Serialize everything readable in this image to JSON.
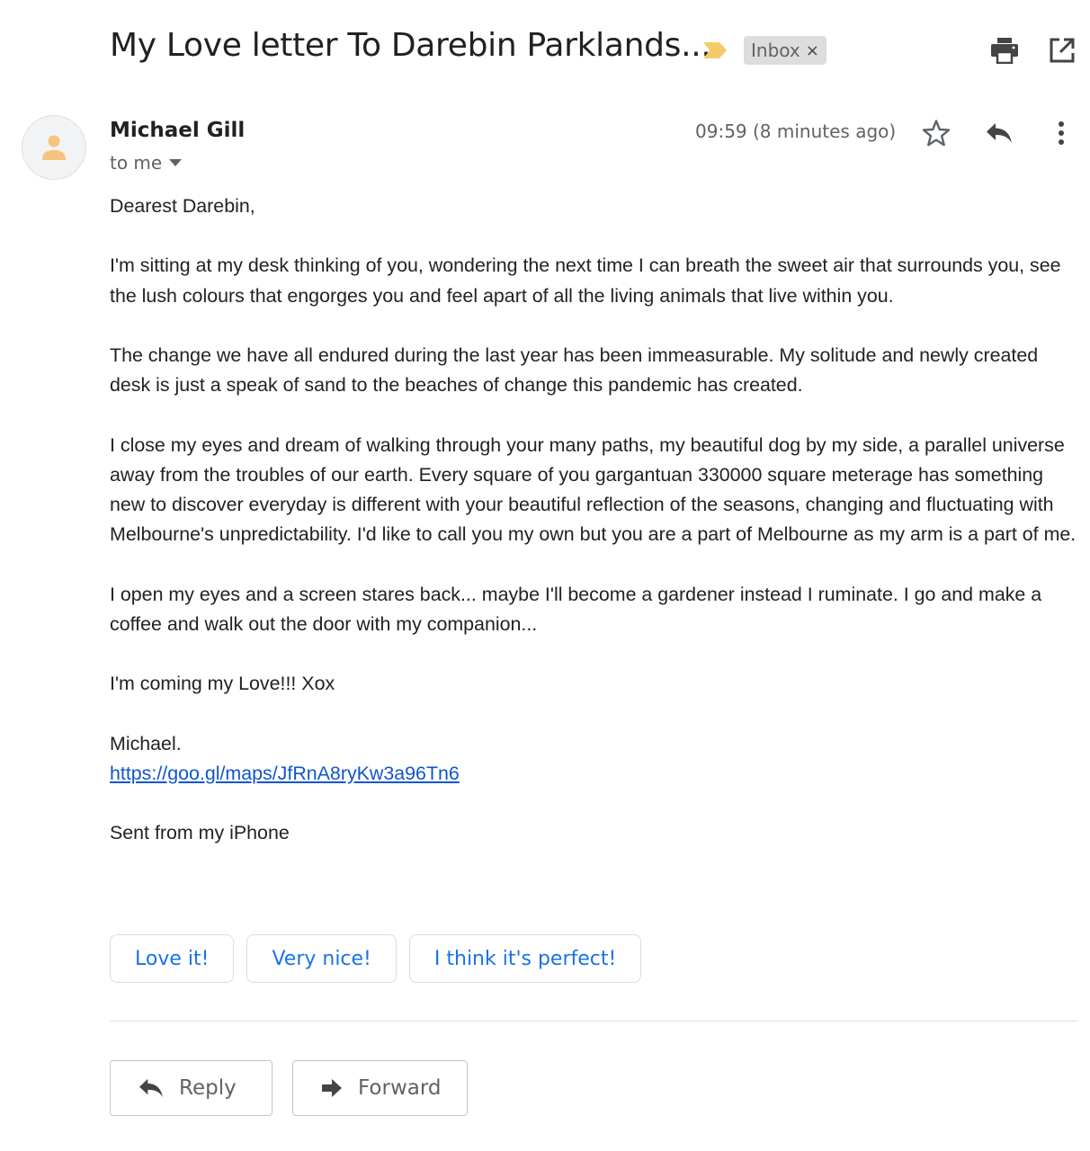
{
  "header": {
    "subject": "My Love letter To Darebin Parklands...",
    "label": "Inbox",
    "label_close": "×",
    "icons": [
      "print-icon",
      "open-in-new-window-icon"
    ]
  },
  "message": {
    "sender_name": "Michael Gill",
    "recipient": "to me",
    "timestamp": "09:59 (8 minutes ago)",
    "icons": [
      "star-icon",
      "reply-icon",
      "more-vert-icon"
    ],
    "body": {
      "greeting": "Dearest Darebin,",
      "p1": "I'm sitting at my desk thinking of you, wondering the next time I can breath the sweet air that surrounds you, see the lush colours that engorges you and feel apart of all the living animals that live within you.",
      "p2": "The change we have all endured during the last year has been immeasurable. My solitude and newly created desk is just a speak of sand to the beaches of change this pandemic has created.",
      "p3": "I close my eyes and dream of walking through your many paths, my beautiful dog by my side, a parallel universe away from the troubles of our earth. Every square of you gargantuan 330000 square meterage has something new to discover everyday is different with your beautiful reflection of the seasons, changing and fluctuating with Melbourne's unpredictability. I'd like to call you my own but you are a part of Melbourne as my arm is a part of me.",
      "p4": "I open my eyes and a screen stares back... maybe I'll become a gardener instead I ruminate. I go and make a coffee and walk out the door with my companion...",
      "p5": "I'm coming my Love!!! Xox",
      "signoff": "Michael.",
      "link": "https://goo.gl/maps/JfRnA8ryKw3a96Tn6",
      "footer": "Sent from my iPhone"
    }
  },
  "smart_replies": [
    "Love it!",
    "Very nice!",
    "I think it's perfect!"
  ],
  "actions": {
    "reply_label": "Reply",
    "forward_label": "Forward"
  },
  "colors": {
    "accent": "#1a73e8",
    "link": "#1155cc",
    "importance_marker": "#f4cb6b",
    "avatar_figure": "#f7c27e"
  }
}
